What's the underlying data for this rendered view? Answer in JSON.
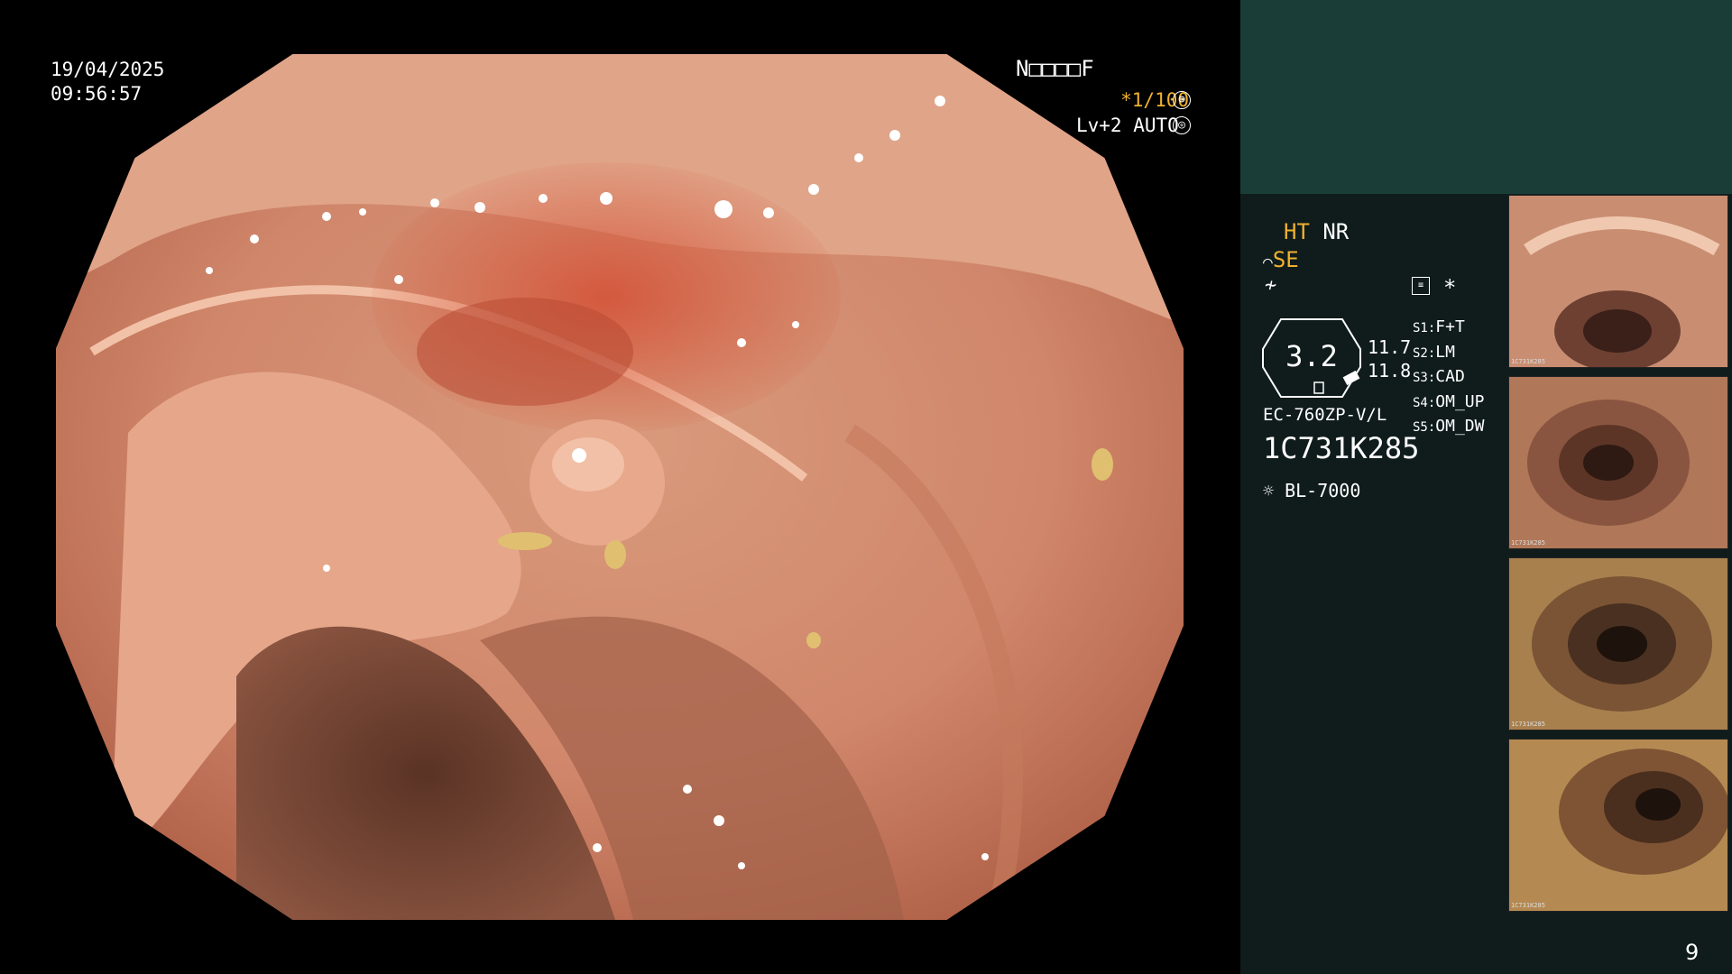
{
  "overlay": {
    "date": "19/04/2025",
    "time": "09:56:57",
    "name_field": "N□□□□F",
    "shutter": "*1/100",
    "light_level": "Lv+2",
    "iris": "AUTO"
  },
  "panel": {
    "mode1_a": "HT",
    "mode1_b": "NR",
    "mode2": "SE",
    "zoom_value": "3.2",
    "value_top": "11.7",
    "value_bottom": "11.8",
    "scope_model": "EC-760ZP-V/L",
    "serial": "1C731K285",
    "light_source": "BL-7000",
    "settings": [
      {
        "key": "S1:",
        "value": "F+T"
      },
      {
        "key": "S2:",
        "value": "LM"
      },
      {
        "key": "S3:",
        "value": "CAD"
      },
      {
        "key": "S4:",
        "value": "OM_UP"
      },
      {
        "key": "S5:",
        "value": "OM_DW"
      }
    ],
    "image_count": "9"
  },
  "thumbnails": [
    {
      "id": "1C731K285"
    },
    {
      "id": "1C731K285"
    },
    {
      "id": "1C731K285"
    },
    {
      "id": "1C731K285"
    }
  ],
  "colors": {
    "accent": "#f0b030",
    "panel_top": "#1b3d38",
    "panel_bg": "#0f1c1b"
  },
  "icons": [
    "freeze-icon",
    "iris-icon",
    "structure-enhance-icon",
    "color-enhance-icon",
    "memo-icon",
    "asterisk-icon",
    "light-source-icon"
  ]
}
